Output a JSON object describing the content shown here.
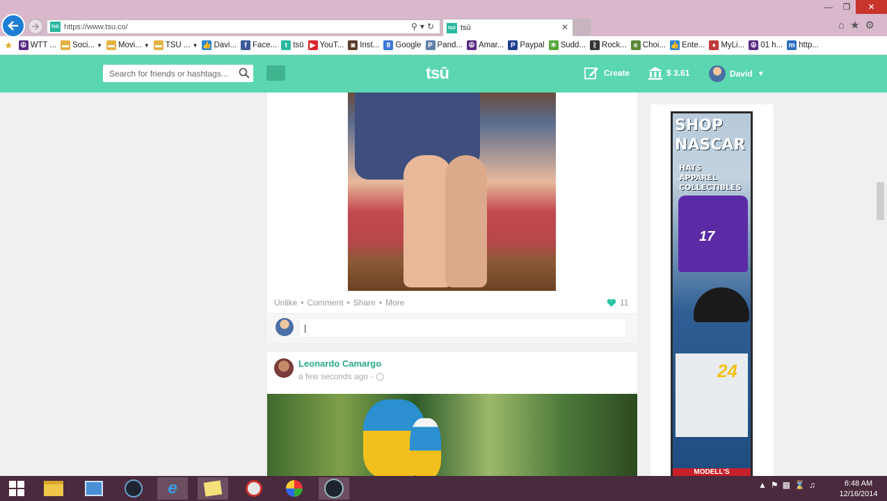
{
  "browser": {
    "url": "https://www.tsu.co/",
    "tab_title": "tsū",
    "tab_favicon": "tsū",
    "favorites": [
      {
        "label": "WTT ...",
        "icon": "peace-icon",
        "color": "#5b2c83"
      },
      {
        "label": "Soci...",
        "icon": "folder-icon",
        "color": "#e3b341"
      },
      {
        "label": "Movi...",
        "icon": "folder-icon",
        "color": "#e3b341"
      },
      {
        "label": "TSU ...",
        "icon": "folder-icon",
        "color": "#e3b341"
      },
      {
        "label": "Davi...",
        "icon": "thumb-icon",
        "color": "#2c86d6"
      },
      {
        "label": "Face...",
        "icon": "facebook-icon",
        "color": "#3b5998"
      },
      {
        "label": "tsū",
        "icon": "tsu-icon",
        "color": "#2bb8a0"
      },
      {
        "label": "YouT...",
        "icon": "youtube-icon",
        "color": "#d8262c"
      },
      {
        "label": "Inst...",
        "icon": "instagram-icon",
        "color": "#5b3c2a"
      },
      {
        "label": "Google",
        "icon": "google-icon",
        "color": "#3c78d8"
      },
      {
        "label": "Pand...",
        "icon": "pandora-icon",
        "color": "#5e7fa6"
      },
      {
        "label": "Amar...",
        "icon": "peace-icon",
        "color": "#5b2c83"
      },
      {
        "label": "Paypal",
        "icon": "paypal-icon",
        "color": "#1d3f8f"
      },
      {
        "label": "Sudd...",
        "icon": "burst-icon",
        "color": "#56a53c"
      },
      {
        "label": "Rock...",
        "icon": "rock-icon",
        "color": "#333333"
      },
      {
        "label": "Choi...",
        "icon": "page-icon",
        "color": "#5b8a3a"
      },
      {
        "label": "Ente...",
        "icon": "thumb-icon",
        "color": "#2c86d6"
      },
      {
        "label": "MyLi...",
        "icon": "mylife-icon",
        "color": "#c0393b"
      },
      {
        "label": "01 h...",
        "icon": "peace-icon",
        "color": "#5b2c83"
      },
      {
        "label": "http...",
        "icon": "mi-icon",
        "color": "#2c6fbf"
      }
    ]
  },
  "header": {
    "search_placeholder": "Search for friends or hashtags...",
    "logo": "tsū",
    "create_label": "Create",
    "balance": "$ 3.61",
    "user_name": "David"
  },
  "post1": {
    "actions": [
      "Unlike",
      "Comment",
      "Share",
      "More"
    ],
    "like_count": "11",
    "comment_value": "|"
  },
  "post2": {
    "author": "Leonardo Camargo",
    "time": "a few seconds ago",
    "time_separator": "-"
  },
  "ad": {
    "headline_1": "SHOP",
    "headline_2": "NASCAR",
    "sub_1": "HATS",
    "sub_2": "APPAREL",
    "sub_3": "COLLECTIBLES",
    "shirt_number": "17",
    "panel_number": "24",
    "footer": "MODELL'S"
  },
  "taskbar": {
    "time": "6:48 AM",
    "date": "12/16/2014"
  }
}
